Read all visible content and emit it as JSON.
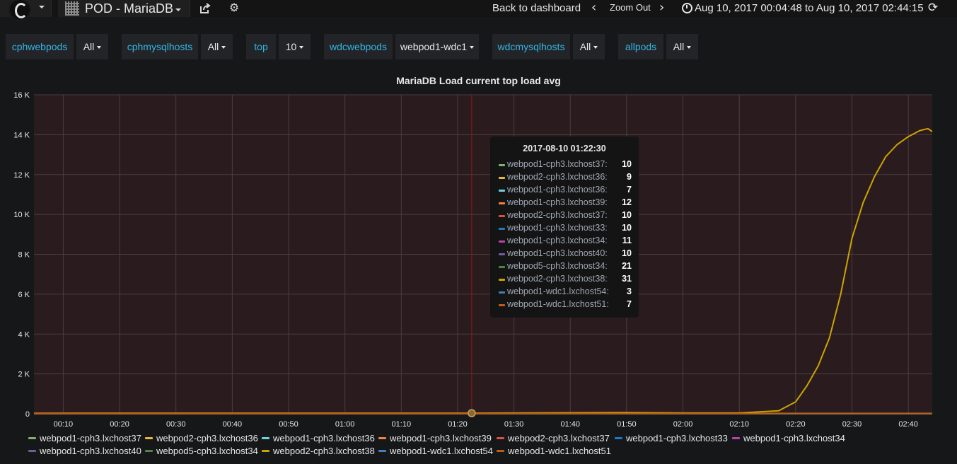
{
  "navbar": {
    "dashboard_title": "POD - MariaDB",
    "back_to_dashboard": "Back to dashboard",
    "zoom_out": "Zoom Out",
    "time_range": "Aug 10, 2017 00:04:48 to Aug 10, 2017 02:44:15",
    "icons": [
      "grafana-logo-icon",
      "dashboard-grid-icon",
      "share-icon",
      "gear-icon",
      "chevron-left-icon",
      "chevron-right-icon",
      "clock-icon",
      "refresh-icon"
    ]
  },
  "variables": [
    {
      "label": "cphwebpods",
      "value": "All"
    },
    {
      "label": "cphmysqlhosts",
      "value": "All"
    },
    {
      "label": "top",
      "value": "10"
    },
    {
      "label": "wdcwebpods",
      "value": "webpod1-wdc1"
    },
    {
      "label": "wdcmysqlhosts",
      "value": "All"
    },
    {
      "label": "allpods",
      "value": "All"
    }
  ],
  "panel": {
    "title": "MariaDB Load current top load avg"
  },
  "chart_data": {
    "type": "line",
    "title": "MariaDB Load current top load avg",
    "x_start": "00:04:48",
    "x_end": "02:44:15",
    "x_tick_labels": [
      "00:10",
      "00:20",
      "00:30",
      "00:40",
      "00:50",
      "01:00",
      "01:10",
      "01:20",
      "01:30",
      "01:40",
      "01:50",
      "02:00",
      "02:10",
      "02:20",
      "02:30",
      "02:40"
    ],
    "y_tick_labels": [
      "0",
      "2 K",
      "4 K",
      "6 K",
      "8 K",
      "10 K",
      "12 K",
      "14 K",
      "16 K"
    ],
    "ylim": [
      0,
      16000
    ],
    "grid": true,
    "legend_position": "bottom",
    "crosshair_time": "01:22:30",
    "series": [
      {
        "name": "webpod1-cph3.lxchost37",
        "color": "#7eb26d",
        "points": [
          [
            "00:04:48",
            10
          ],
          [
            "02:44:15",
            10
          ]
        ]
      },
      {
        "name": "webpod2-cph3.lxchost36",
        "color": "#eab839",
        "points": [
          [
            "00:04:48",
            9
          ],
          [
            "02:44:15",
            9
          ]
        ]
      },
      {
        "name": "webpod1-cph3.lxchost36",
        "color": "#6ed0e0",
        "points": [
          [
            "00:04:48",
            7
          ],
          [
            "02:44:15",
            7
          ]
        ]
      },
      {
        "name": "webpod1-cph3.lxchost39",
        "color": "#ef843c",
        "points": [
          [
            "00:04:48",
            12
          ],
          [
            "02:44:15",
            12
          ]
        ]
      },
      {
        "name": "webpod2-cph3.lxchost37",
        "color": "#e24d42",
        "points": [
          [
            "00:04:48",
            10
          ],
          [
            "02:44:15",
            10
          ]
        ]
      },
      {
        "name": "webpod1-cph3.lxchost33",
        "color": "#1f78c1",
        "points": [
          [
            "00:04:48",
            10
          ],
          [
            "02:44:15",
            10
          ]
        ]
      },
      {
        "name": "webpod1-cph3.lxchost34",
        "color": "#ba43a9",
        "points": [
          [
            "00:04:48",
            11
          ],
          [
            "02:44:15",
            11
          ]
        ]
      },
      {
        "name": "webpod1-cph3.lxchost40",
        "color": "#705da0",
        "points": [
          [
            "00:04:48",
            10
          ],
          [
            "02:44:15",
            10
          ]
        ]
      },
      {
        "name": "webpod5-cph3.lxchost34",
        "color": "#508642",
        "points": [
          [
            "00:04:48",
            21
          ],
          [
            "02:44:15",
            21
          ]
        ]
      },
      {
        "name": "webpod2-cph3.lxchost38",
        "color": "#cca300",
        "points": [
          [
            "00:04:48",
            30
          ],
          [
            "01:22:30",
            31
          ],
          [
            "01:50:00",
            60
          ],
          [
            "02:00:00",
            40
          ],
          [
            "02:10:00",
            40
          ],
          [
            "02:17:00",
            150
          ],
          [
            "02:20:00",
            600
          ],
          [
            "02:22:00",
            1400
          ],
          [
            "02:24:00",
            2400
          ],
          [
            "02:26:00",
            3800
          ],
          [
            "02:28:00",
            6000
          ],
          [
            "02:30:00",
            8800
          ],
          [
            "02:32:00",
            10600
          ],
          [
            "02:34:00",
            11900
          ],
          [
            "02:36:00",
            12900
          ],
          [
            "02:38:00",
            13500
          ],
          [
            "02:40:00",
            13900
          ],
          [
            "02:42:00",
            14200
          ],
          [
            "02:43:30",
            14300
          ],
          [
            "02:44:15",
            14150
          ]
        ]
      },
      {
        "name": "webpod1-wdc1.lxchost54",
        "color": "#447ebc",
        "points": [
          [
            "00:04:48",
            3
          ],
          [
            "02:44:15",
            3
          ]
        ]
      },
      {
        "name": "webpod1-wdc1.lxchost51",
        "color": "#c15c17",
        "points": [
          [
            "00:04:48",
            7
          ],
          [
            "02:44:15",
            7
          ]
        ]
      }
    ]
  },
  "tooltip": {
    "time": "2017-08-10 01:22:30",
    "rows": [
      {
        "name": "webpod1-cph3.lxchost37:",
        "value": "10",
        "color": "#7eb26d"
      },
      {
        "name": "webpod2-cph3.lxchost36:",
        "value": "9",
        "color": "#eab839"
      },
      {
        "name": "webpod1-cph3.lxchost36:",
        "value": "7",
        "color": "#6ed0e0"
      },
      {
        "name": "webpod1-cph3.lxchost39:",
        "value": "12",
        "color": "#ef843c"
      },
      {
        "name": "webpod2-cph3.lxchost37:",
        "value": "10",
        "color": "#e24d42"
      },
      {
        "name": "webpod1-cph3.lxchost33:",
        "value": "10",
        "color": "#1f78c1"
      },
      {
        "name": "webpod1-cph3.lxchost34:",
        "value": "11",
        "color": "#ba43a9"
      },
      {
        "name": "webpod1-cph3.lxchost40:",
        "value": "10",
        "color": "#705da0"
      },
      {
        "name": "webpod5-cph3.lxchost34:",
        "value": "21",
        "color": "#508642"
      },
      {
        "name": "webpod2-cph3.lxchost38:",
        "value": "31",
        "color": "#cca300"
      },
      {
        "name": "webpod1-wdc1.lxchost54:",
        "value": "3",
        "color": "#447ebc"
      },
      {
        "name": "webpod1-wdc1.lxchost51:",
        "value": "7",
        "color": "#c15c17"
      }
    ]
  },
  "colors": {
    "background": "#161719",
    "variable_label": "#33b5e5",
    "plot_background": "#2a1c1e",
    "crosshair": "#8b1a1a"
  }
}
